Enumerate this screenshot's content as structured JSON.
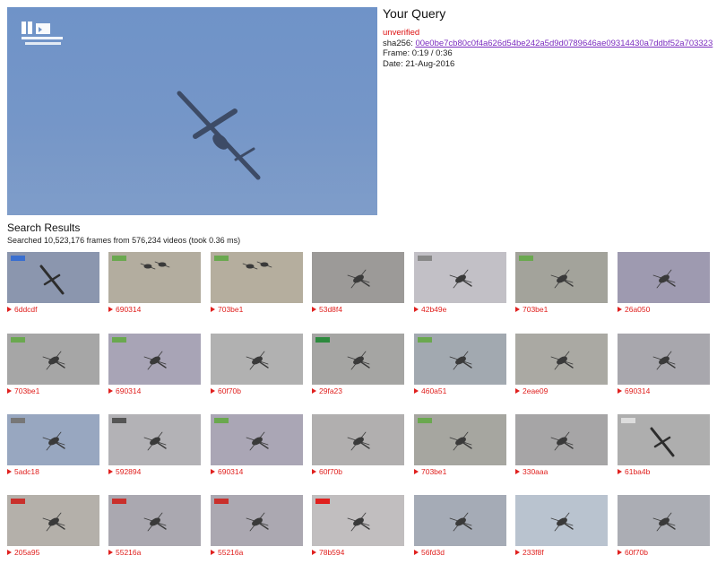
{
  "query": {
    "title": "Your Query",
    "status": "unverified",
    "sha_label": "sha256:",
    "sha_value": "00e0be7cb80c0f4a626d54be242a5d9d0789646ae09314430a7ddbf52a703323",
    "frame_label": "Frame:",
    "frame_value": "0:19 / 0:36",
    "date_label": "Date:",
    "date_value": "21-Aug-2016"
  },
  "results": {
    "title": "Search Results",
    "summary": "Searched 10,523,176 frames from 576,234 videos (took 0.36 ms)"
  },
  "colors": {
    "accent_red": "#e0201e",
    "link_purple": "#7b2cbf",
    "sky_blue": "#7596c8"
  },
  "tiles": [
    {
      "id": "6ddcdf",
      "craft": "drone",
      "bg": "#8b96ae",
      "badge": "#3a6fcf"
    },
    {
      "id": "690314",
      "craft": "pair",
      "bg": "#b3ad9f",
      "badge": "#6aa84f"
    },
    {
      "id": "703be1",
      "craft": "pair",
      "bg": "#b5ae9e",
      "badge": "#6aa84f"
    },
    {
      "id": "53d8f4",
      "craft": "heli",
      "bg": "#9c9a98",
      "badge": ""
    },
    {
      "id": "42b49e",
      "craft": "heli",
      "bg": "#c2c0c6",
      "badge": "#888888"
    },
    {
      "id": "703be1",
      "craft": "heli",
      "bg": "#a3a39b",
      "badge": "#6aa84f"
    },
    {
      "id": "26a050",
      "craft": "heli",
      "bg": "#9e9ab0",
      "badge": ""
    },
    {
      "id": "703be1",
      "craft": "heli",
      "bg": "#a6a6a6",
      "badge": "#6aa84f"
    },
    {
      "id": "690314",
      "craft": "heli",
      "bg": "#a8a4b6",
      "badge": "#6aa84f"
    },
    {
      "id": "60f70b",
      "craft": "heli",
      "bg": "#b1b1b1",
      "badge": ""
    },
    {
      "id": "29fa23",
      "craft": "heli",
      "bg": "#a5a5a3",
      "badge": "#2d8a3e"
    },
    {
      "id": "460a51",
      "craft": "heli",
      "bg": "#a2a9b0",
      "badge": "#6aa84f"
    },
    {
      "id": "2eae09",
      "craft": "heli",
      "bg": "#aaa9a3",
      "badge": ""
    },
    {
      "id": "690314",
      "craft": "heli",
      "bg": "#a8a7ad",
      "badge": ""
    },
    {
      "id": "5adc18",
      "craft": "heli",
      "bg": "#98a7c0",
      "badge": "#777777"
    },
    {
      "id": "592894",
      "craft": "heli",
      "bg": "#b3b2b6",
      "badge": "#555555"
    },
    {
      "id": "690314",
      "craft": "heli",
      "bg": "#aaa6b5",
      "badge": "#6aa84f"
    },
    {
      "id": "60f70b",
      "craft": "heli",
      "bg": "#b1afaf",
      "badge": ""
    },
    {
      "id": "703be1",
      "craft": "heli",
      "bg": "#a6a6a0",
      "badge": "#6aa84f"
    },
    {
      "id": "330aaa",
      "craft": "heli",
      "bg": "#a6a5a6",
      "badge": ""
    },
    {
      "id": "61ba4b",
      "craft": "drone",
      "bg": "#aeaeae",
      "badge": "#dddddd"
    },
    {
      "id": "205a95",
      "craft": "heli",
      "bg": "#b4b0aa",
      "badge": "#c9302c"
    },
    {
      "id": "55216a",
      "craft": "heli",
      "bg": "#aaa8b0",
      "badge": "#c9302c"
    },
    {
      "id": "55216a",
      "craft": "heli",
      "bg": "#aba8b1",
      "badge": "#c9302c"
    },
    {
      "id": "78b594",
      "craft": "heli",
      "bg": "#c1bebf",
      "badge": "#e0201e"
    },
    {
      "id": "56fd3d",
      "craft": "heli",
      "bg": "#a5abb6",
      "badge": ""
    },
    {
      "id": "233f8f",
      "craft": "heli",
      "bg": "#b9c3cf",
      "badge": ""
    },
    {
      "id": "60f70b",
      "craft": "heli",
      "bg": "#abadb4",
      "badge": ""
    }
  ]
}
